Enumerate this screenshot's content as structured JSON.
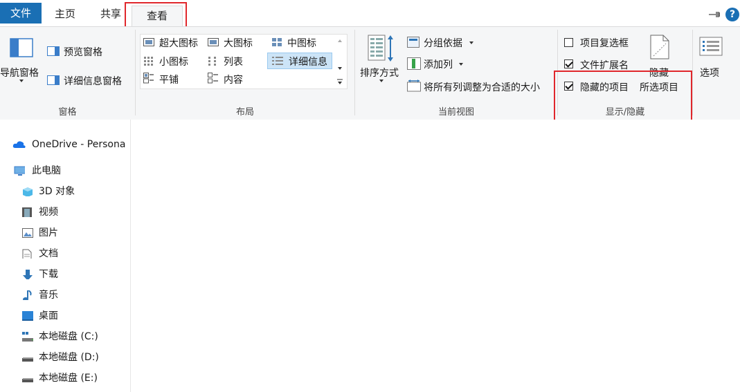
{
  "tabs": {
    "file": "文件",
    "home": "主页",
    "share": "共享",
    "view": "查看"
  },
  "ribbon": {
    "panes": {
      "label": "窗格",
      "nav_pane": "导航窗格",
      "preview_pane": "预览窗格",
      "details_pane": "详细信息窗格"
    },
    "layout": {
      "label": "布局",
      "items": [
        "超大图标",
        "大图标",
        "中图标",
        "小图标",
        "列表",
        "详细信息",
        "平铺",
        "内容"
      ],
      "selected": "详细信息"
    },
    "current_view": {
      "label": "当前视图",
      "sort_by": "排序方式",
      "group_by": "分组依据",
      "add_columns": "添加列",
      "size_columns": "将所有列调整为合适的大小"
    },
    "show_hide": {
      "label": "显示/隐藏",
      "item_checkboxes": "项目复选框",
      "file_extensions": "文件扩展名",
      "hidden_items": "隐藏的项目",
      "hide_selected_line1": "隐藏",
      "hide_selected_line2": "所选项目",
      "checked": {
        "item_checkboxes": false,
        "file_extensions": true,
        "hidden_items": true
      }
    },
    "options": "选项"
  },
  "nav": {
    "onedrive": "OneDrive - Persona",
    "this_pc": "此电脑",
    "items": [
      "3D 对象",
      "视频",
      "图片",
      "文档",
      "下载",
      "音乐",
      "桌面",
      "本地磁盘 (C:)",
      "本地磁盘 (D:)",
      "本地磁盘 (E:)"
    ]
  },
  "colors": {
    "file_tab": "#1a6fb4",
    "highlight": "#e0262b",
    "selected": "#cce4f7",
    "ribbon_bg": "#f5f6f7"
  }
}
